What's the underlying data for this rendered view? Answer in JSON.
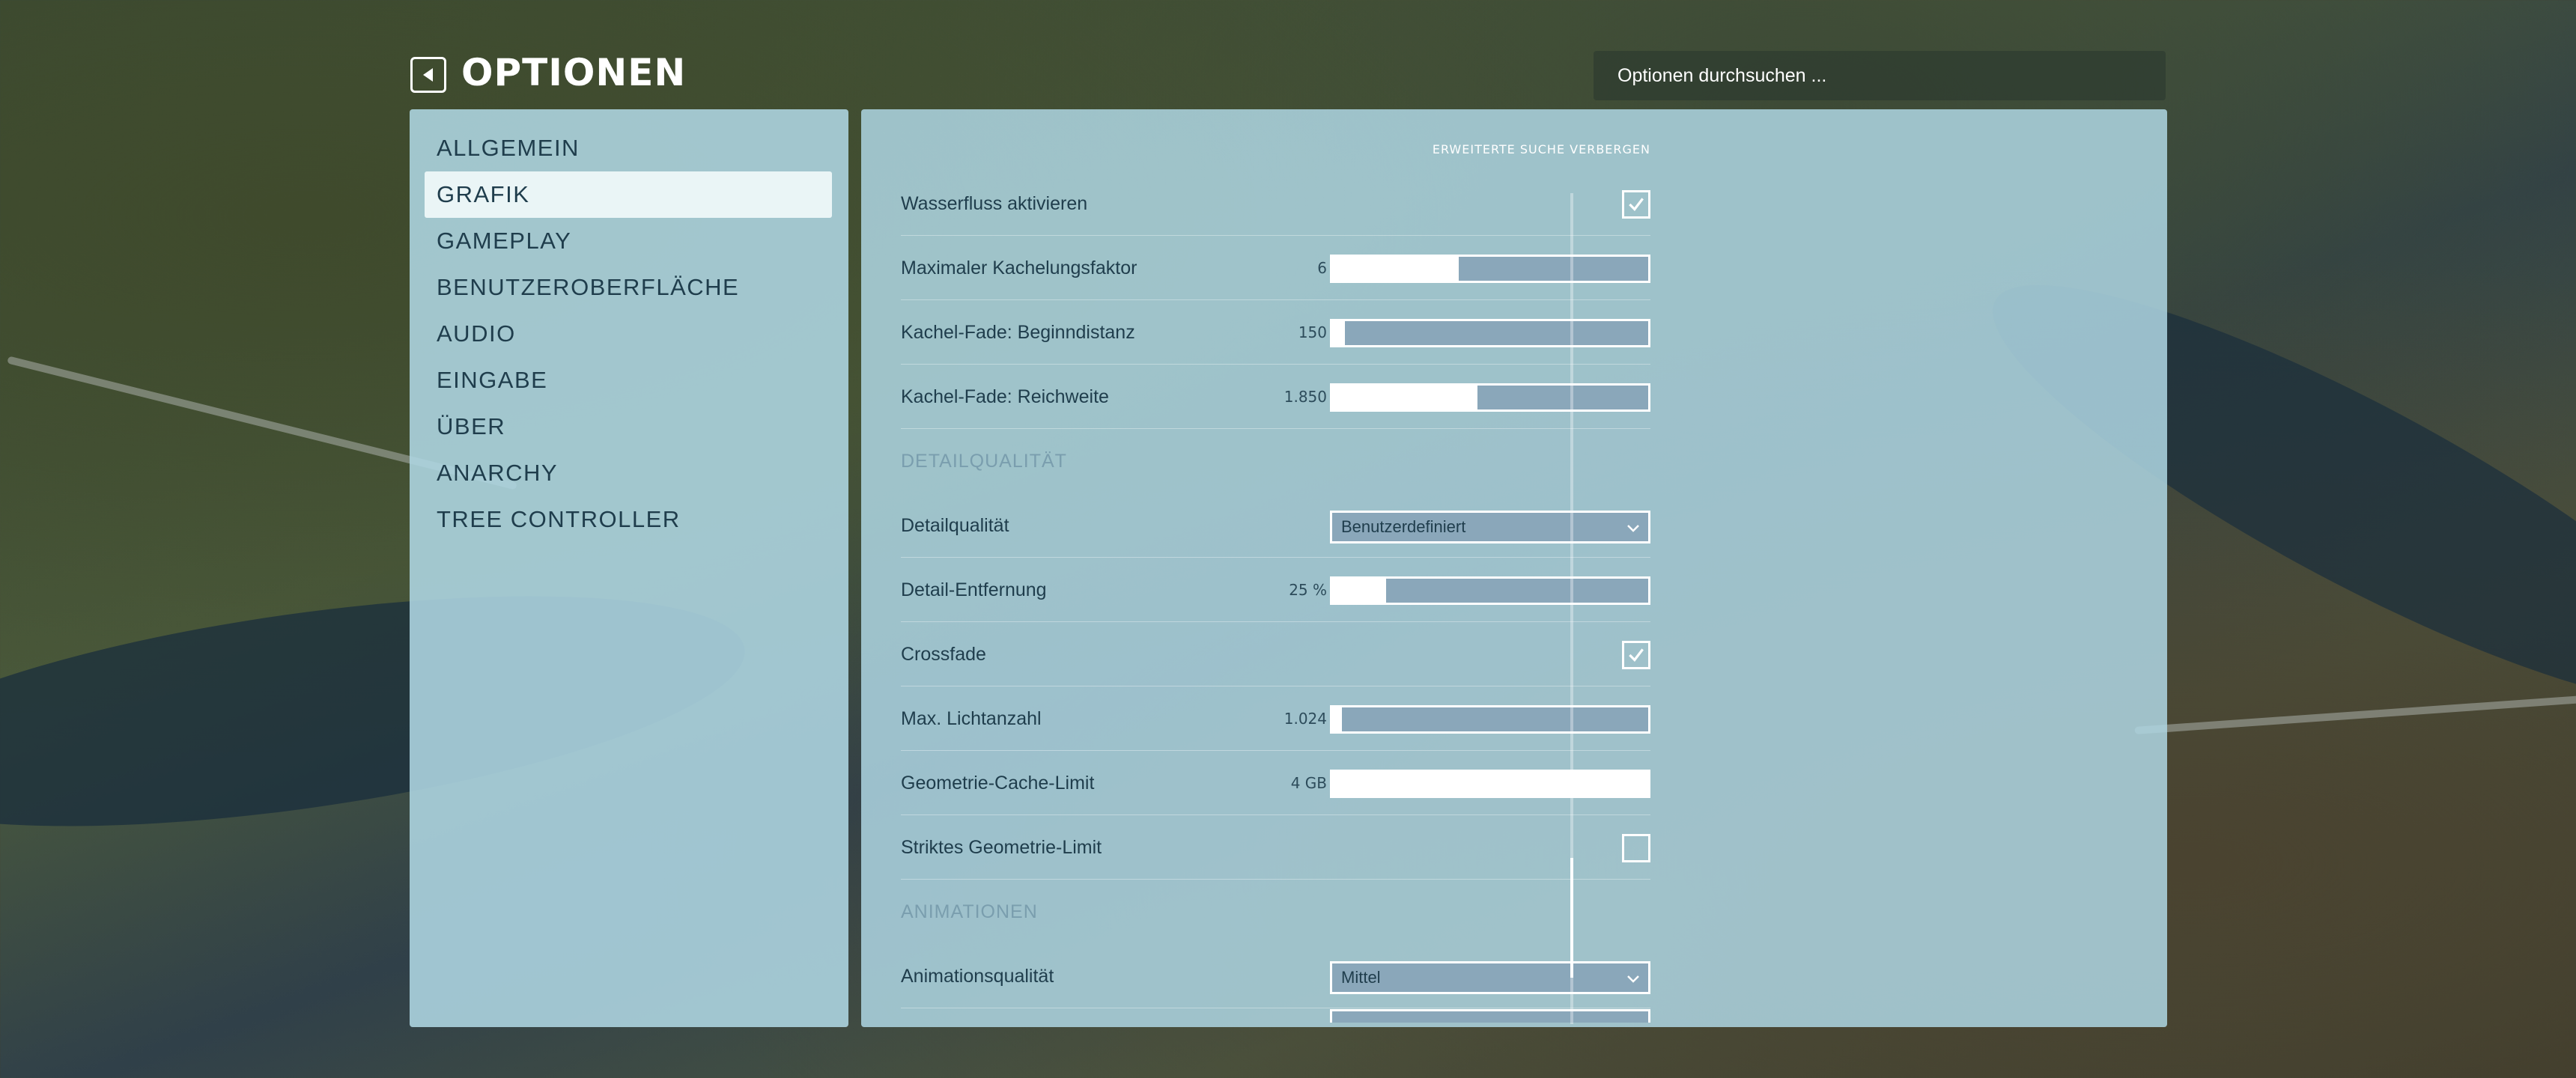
{
  "header": {
    "back_icon": "back-arrow-icon",
    "title": "OPTIONEN"
  },
  "search": {
    "placeholder": "Optionen durchsuchen ..."
  },
  "sidebar": {
    "items": [
      {
        "label": "ALLGEMEIN",
        "active": false
      },
      {
        "label": "GRAFIK",
        "active": true
      },
      {
        "label": "GAMEPLAY",
        "active": false
      },
      {
        "label": "BENUTZEROBERFLÄCHE",
        "active": false
      },
      {
        "label": "AUDIO",
        "active": false
      },
      {
        "label": "EINGABE",
        "active": false
      },
      {
        "label": "ÜBER",
        "active": false
      },
      {
        "label": "ANARCHY",
        "active": false
      },
      {
        "label": "TREE CONTROLLER",
        "active": false
      }
    ]
  },
  "content": {
    "advanced_toggle": "ERWEITERTE SUCHE VERBERGEN",
    "settings": {
      "wasserfluss": {
        "label": "Wasserfluss aktivieren",
        "checked": true
      },
      "kachelungsfaktor": {
        "label": "Maximaler Kachelungsfaktor",
        "value": "6",
        "fraction": 0.4
      },
      "beginndistanz": {
        "label": "Kachel-Fade: Beginndistanz",
        "value": "150",
        "fraction": 0.04
      },
      "reichweite": {
        "label": "Kachel-Fade: Reichweite",
        "value": "1.850",
        "fraction": 0.46
      },
      "section_detail": "DETAILQUALITÄT",
      "detailqualitaet": {
        "label": "Detailqualität",
        "value": "Benutzerdefiniert"
      },
      "detail_entfernung": {
        "label": "Detail-Entfernung",
        "value": "25 %",
        "fraction": 0.17
      },
      "crossfade": {
        "label": "Crossfade",
        "checked": true
      },
      "lichtanzahl": {
        "label": "Max. Lichtanzahl",
        "value": "1.024",
        "fraction": 0.03
      },
      "cache_limit": {
        "label": "Geometrie-Cache-Limit",
        "value": "4 GB",
        "fraction": 1.0
      },
      "striktes_limit": {
        "label": "Striktes Geometrie-Limit",
        "checked": false
      },
      "section_animation": "ANIMATIONEN",
      "animationsqualitaet": {
        "label": "Animationsqualität",
        "value": "Mittel"
      }
    }
  },
  "colors": {
    "panel": "#afd7e4",
    "text": "#1f3d4c",
    "section": "#7a9eae",
    "slider_track": "#8aa7ba"
  }
}
